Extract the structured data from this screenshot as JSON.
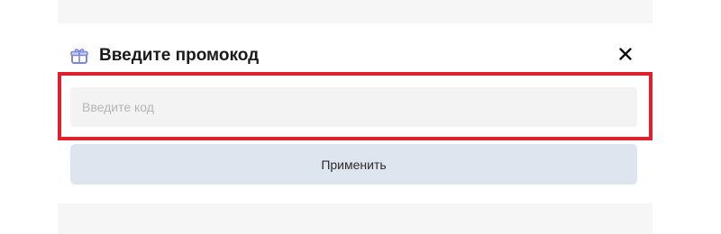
{
  "dialog": {
    "title": "Введите промокод",
    "icon": "gift-icon",
    "close_icon": "close-icon",
    "code_input": {
      "placeholder": "Введите код",
      "value": ""
    },
    "apply_label": "Применить"
  },
  "colors": {
    "highlight": "#e0202c",
    "button_bg": "#dfe5ee",
    "input_bg": "#f3f3f3",
    "icon_accent": "#7b86d9"
  }
}
